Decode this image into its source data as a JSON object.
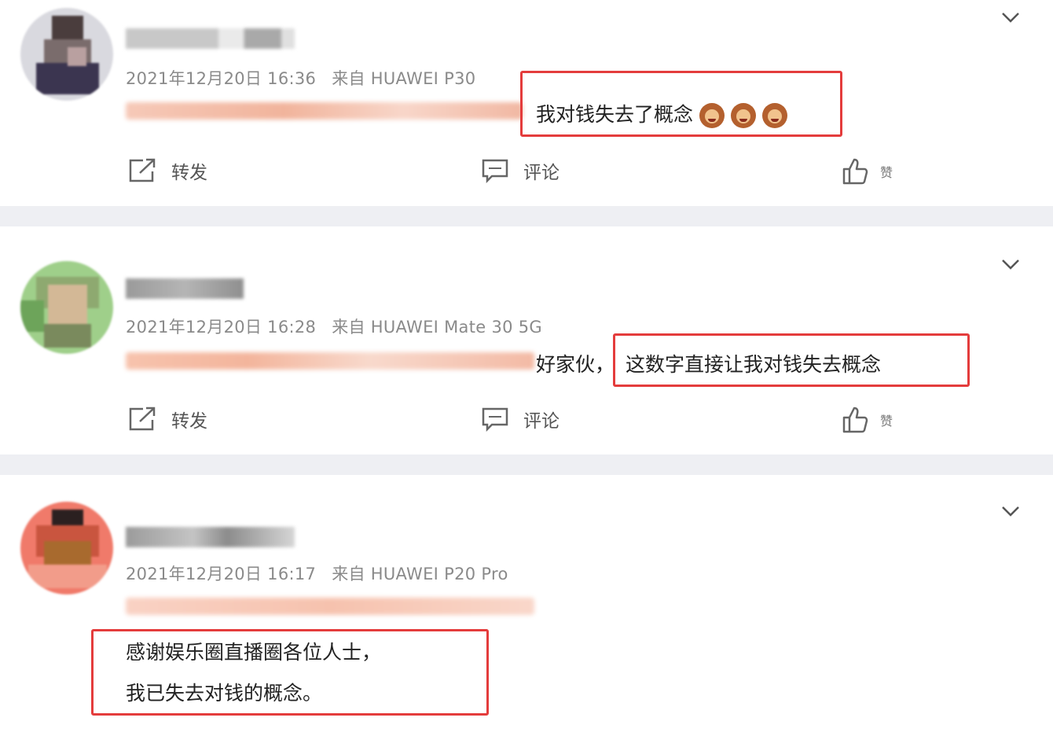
{
  "colors": {
    "highlight": "#e43c3c",
    "meta": "#8a8a8a",
    "divider": "#eeeff3"
  },
  "actions": {
    "repost_label": "转发",
    "comment_label": "评论",
    "like_label": "赞"
  },
  "posts": [
    {
      "timestamp": "2021年12月20日 16:36",
      "source": "来自 HUAWEI P30",
      "text": "我对钱失去了概念",
      "emoji_icons": [
        "woman-emoji-icon",
        "woman-emoji-icon",
        "woman-emoji-icon"
      ]
    },
    {
      "timestamp": "2021年12月20日 16:28",
      "source": "来自 HUAWEI Mate 30 5G",
      "prefix_text": "好家伙，",
      "text": "这数字直接让我对钱失去概念"
    },
    {
      "timestamp": "2021年12月20日 16:17",
      "source": "来自 HUAWEI P20 Pro",
      "text_line1": "感谢娱乐圈直播圈各位人士，",
      "text_line2": "我已失去对钱的概念。"
    }
  ]
}
